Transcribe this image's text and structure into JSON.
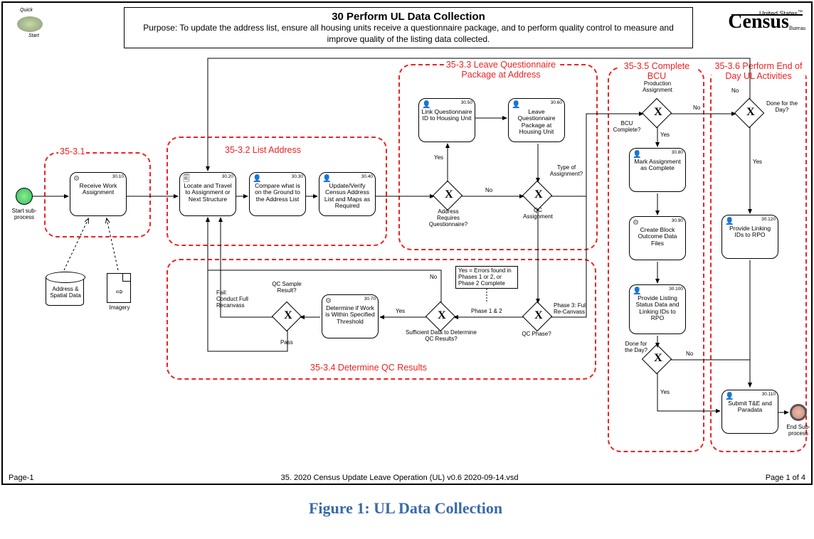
{
  "header": {
    "title": "30 Perform UL Data Collection",
    "purpose": "Purpose: To update the address list, ensure all housing units receive a questionnaire package, and to perform quality control to measure and improve quality of the listing data collected."
  },
  "logo": {
    "top": "United States",
    "main": "Census",
    "sub": "Bureau",
    "tm": "™"
  },
  "footer": {
    "left": "Page-1",
    "center": "35. 2020 Census Update Leave Operation (UL) v0.6 2020-09-14.vsd",
    "right": "Page 1 of 4"
  },
  "caption": "Figure 1: UL Data Collection",
  "viz_labels": {
    "quick": "Quick",
    "start": "Start"
  },
  "events": {
    "start": "Start sub-process",
    "end": "End Sub-process"
  },
  "datastores": {
    "addr": "Address & Spatial Data",
    "img": "Imagery"
  },
  "groups": {
    "g1": "35-3.1",
    "g2": "35-3.2 List Address",
    "g3": "35-3.3 Leave Questionnaire Package at Address",
    "g4": "35-3.4 Determine QC Results",
    "g5": "35-3.5 Complete BCU",
    "g6": "35-3.6 Perform End of Day UL Activities"
  },
  "tasks": {
    "t10": {
      "id": "30.10",
      "label": "Receive Work Assignment"
    },
    "t20": {
      "id": "30.20",
      "label": "Locate and Travel to Assignment or Next Structure"
    },
    "t30": {
      "id": "30.30",
      "label": "Compare what is on the Ground to the Address List"
    },
    "t40": {
      "id": "30.40",
      "label": "Update/Verify Census Address List and Maps as Required"
    },
    "t50": {
      "id": "30.50",
      "label": "Link Questionnaire ID to Housing Unit"
    },
    "t60": {
      "id": "30.60",
      "label": "Leave Questionnaire Package at Housing Unit"
    },
    "t70": {
      "id": "30.70",
      "label": "Determine if Work is Within Specified Threshold"
    },
    "t80": {
      "id": "30.80",
      "label": "Mark Assignment as Complete"
    },
    "t90": {
      "id": "30.90",
      "label": "Create Block Outcome Data Files"
    },
    "t100": {
      "id": "30.100",
      "label": "Provide Listing Status Data and Linking IDs to RPO"
    },
    "t110": {
      "id": "30.110",
      "label": "Submit T&E and Paradata"
    },
    "t120": {
      "id": "30.120",
      "label": "Provide Linking IDs to RPO"
    }
  },
  "gateways": {
    "gwARQ": "Address Requires Questionnaire?",
    "gwTA": "Type of Assignment?",
    "gwQP": "QC Phase?",
    "gwSD": "Sufficient Data to Determine QC Results?",
    "gwQS": "QC Sample Result?",
    "gwPA": "Production Assignment",
    "gwBCU": "BCU Complete?",
    "gwDD": "Done for the Day?",
    "gwDD2": "Done for the Day?"
  },
  "edge_labels": {
    "yes": "Yes",
    "no": "No",
    "qcAssign": "QC Assignment",
    "p12": "Phase 1 & 2",
    "p3": "Phase 3: Full Re-Canvass",
    "fail": "Fail: Conduct Full Recanvass",
    "pass": "Pass",
    "note_yes": "Yes = Errors found in Phases 1 or 2, or Phase 2 Complete"
  }
}
